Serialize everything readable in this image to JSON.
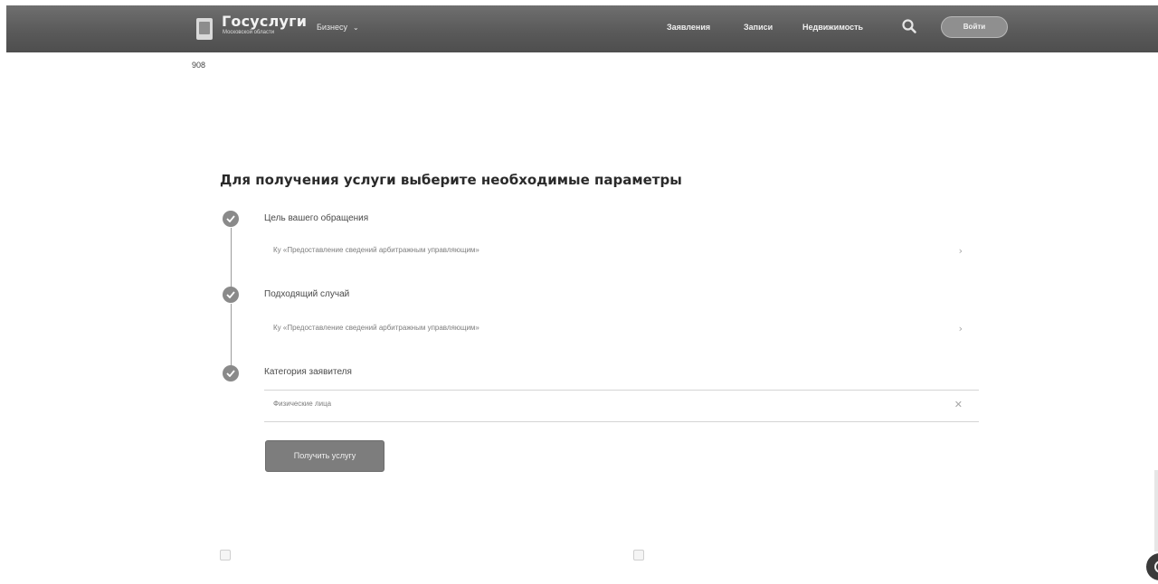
{
  "header": {
    "logo_title": "Госуслуги",
    "logo_subtitle": "Московской области",
    "business_dropdown": "Бизнесу",
    "nav": [
      "Заявления",
      "Записи",
      "Недвижимость"
    ],
    "login_label": "Войти"
  },
  "page": {
    "code": "908",
    "heading": "Для получения услуги выберите необходимые параметры"
  },
  "steps": [
    {
      "label": "Цель вашего обращения",
      "value": "Ку «Предоставление сведений арбитражным управляющим»"
    },
    {
      "label": "Подходящий случай",
      "value": "Ку «Предоставление сведений арбитражным управляющим»"
    },
    {
      "label": "Категория заявителя",
      "value": "Физические лица"
    }
  ],
  "submit_label": "Получить услугу",
  "icons": {
    "search": "search-icon",
    "check": "check-icon",
    "clear": "close-icon"
  }
}
